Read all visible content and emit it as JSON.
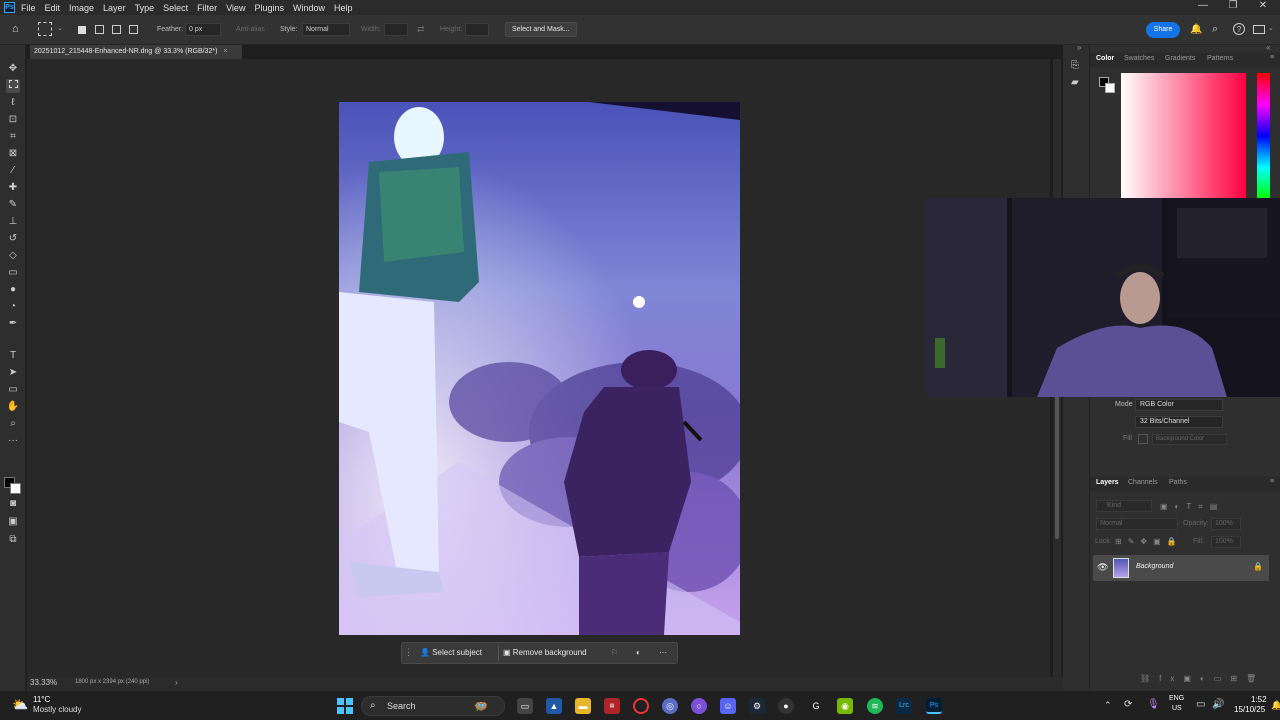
{
  "menubar": {
    "logo": "Ps",
    "items": [
      "File",
      "Edit",
      "Image",
      "Layer",
      "Type",
      "Select",
      "Filter",
      "View",
      "Plugins",
      "Window",
      "Help"
    ],
    "minimize": "—",
    "maximize": "❐",
    "close": "✕"
  },
  "options": {
    "feather_label": "Feather:",
    "feather_value": "0 px",
    "antialias_label": "Anti-alias",
    "style_label": "Style:",
    "style_value": "Normal",
    "width_label": "Width:",
    "height_label": "Height:",
    "select_mask_button": "Select and Mask...",
    "share_button": "Share"
  },
  "document": {
    "tab_title": "20251012_215448-Enhanced-NR.dng @ 33.3% (RGB/32*)",
    "tab_close": "×"
  },
  "color_panel": {
    "tabs": [
      "Color",
      "Swatches",
      "Gradients",
      "Patterns"
    ],
    "active_tab": "Color",
    "hue_color": "#ff0040"
  },
  "properties": {
    "mode_label": "Mode",
    "mode_value": "RGB Color",
    "bits_value": "32 Bits/Channel",
    "fill_label": "Fill",
    "fill_value": "Background Color"
  },
  "layers_panel": {
    "tabs": [
      "Layers",
      "Channels",
      "Paths"
    ],
    "kind_placeholder": "Kind",
    "blend_mode": "Normal",
    "opacity_label": "Opacity:",
    "opacity_value": "100%",
    "lock_label": "Lock:",
    "fill_label": "Fill:",
    "fill_value": "100%",
    "layers": [
      {
        "name": "Background",
        "visible": true,
        "locked": true
      }
    ]
  },
  "context_bar": {
    "select_subject": "Select subject",
    "remove_background": "Remove background",
    "more": "···"
  },
  "status": {
    "zoom": "33.33%",
    "doc_info": "1800 px x 2394 px (240 ppi)"
  },
  "taskbar": {
    "weather_temp": "11°C",
    "weather_desc": "Mostly cloudy",
    "search_label": "Search",
    "language": "ENG",
    "region": "US",
    "time": "1:52",
    "date": "15/10/25"
  }
}
